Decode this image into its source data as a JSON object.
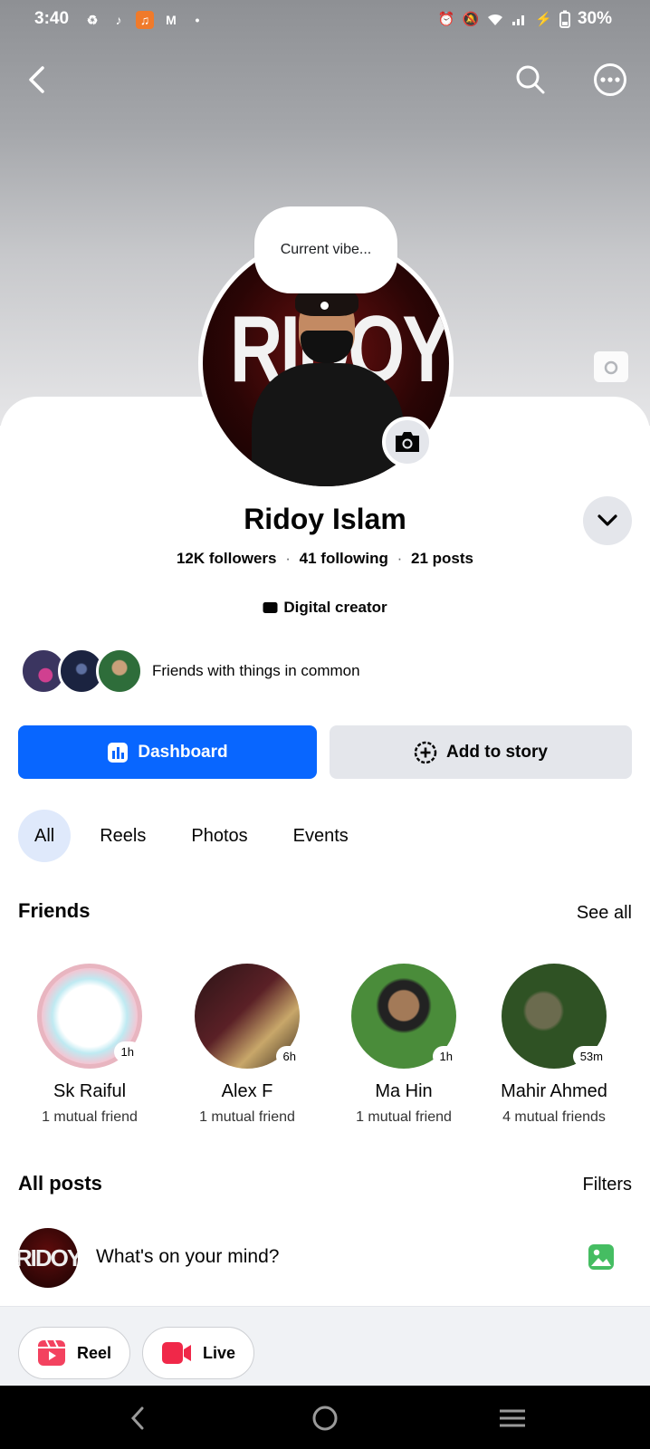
{
  "status_bar": {
    "time": "3:40",
    "battery": "30%",
    "app_icons": [
      "sync-icon",
      "tiktok-icon",
      "music-app-icon",
      "gmail-icon",
      "dot-icon"
    ],
    "system_icons": [
      "alarm-icon",
      "mute-icon",
      "wifi-icon",
      "signal-icon",
      "charging-icon",
      "battery-icon"
    ]
  },
  "header": {
    "back_icon": "back-arrow-icon",
    "search_icon": "search-icon",
    "more_icon": "more-options-icon"
  },
  "profile": {
    "vibe_prompt": "Current vibe...",
    "name": "Ridoy Islam",
    "followers": "12K followers",
    "following": "41 following",
    "posts": "21 posts",
    "separator": "·",
    "category": "Digital creator",
    "avatar_text": "RIDOY",
    "common_friends_label": "Friends with things in common"
  },
  "actions": {
    "dashboard_label": "Dashboard",
    "add_story_label": "Add to story"
  },
  "tabs": [
    {
      "label": "All",
      "active": true
    },
    {
      "label": "Reels",
      "active": false
    },
    {
      "label": "Photos",
      "active": false
    },
    {
      "label": "Events",
      "active": false
    }
  ],
  "friends": {
    "title": "Friends",
    "see_all": "See all",
    "items": [
      {
        "name": "Sk Raiful",
        "mutual": "1 mutual friend",
        "badge": "1h"
      },
      {
        "name": "Alex F",
        "mutual": "1 mutual friend",
        "badge": "6h"
      },
      {
        "name": "Ma Hin",
        "mutual": "1 mutual friend",
        "badge": "1h"
      },
      {
        "name": "Mahir Ahmed",
        "mutual": "4 mutual friends",
        "badge": "53m"
      }
    ]
  },
  "posts": {
    "title": "All posts",
    "filters": "Filters",
    "composer_prompt": "What's on your mind?",
    "composer_avatar_text": "RIDOY"
  },
  "quick_actions": {
    "reel_label": "Reel",
    "live_label": "Live"
  },
  "colors": {
    "accent": "#0866ff",
    "reel": "#f3425f",
    "live": "#f02849",
    "photo": "#45bd62",
    "active_tab": "#dfe9fb"
  }
}
